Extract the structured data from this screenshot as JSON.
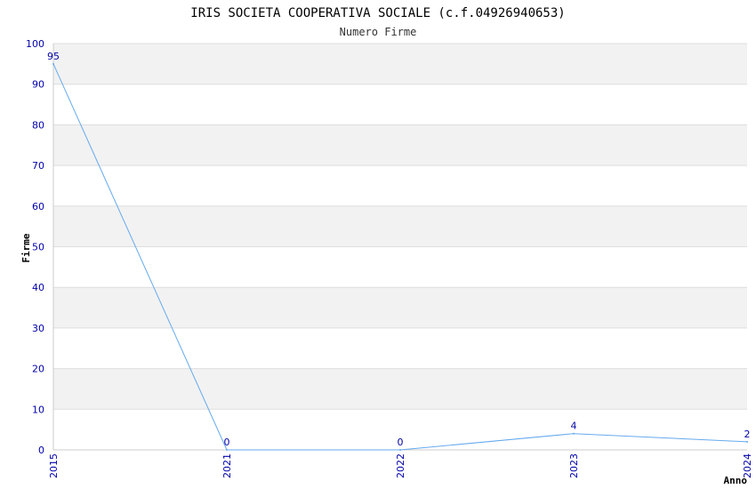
{
  "chart_data": {
    "type": "line",
    "title": "IRIS SOCIETA COOPERATIVA SOCIALE (c.f.04926940653)",
    "subtitle": "Numero Firme",
    "xlabel": "Anno",
    "ylabel": "Firme",
    "categories": [
      "2015",
      "2021",
      "2022",
      "2023",
      "2024"
    ],
    "series": [
      {
        "values": [
          95,
          0,
          0,
          4,
          2
        ]
      }
    ],
    "data_labels": [
      "95",
      "0",
      "0",
      "4",
      "2"
    ],
    "ylim": [
      0,
      100
    ],
    "yticks": [
      "0",
      "10",
      "20",
      "30",
      "40",
      "50",
      "60",
      "70",
      "80",
      "90",
      "100"
    ],
    "grid": true,
    "colors": {
      "line": "#66aaee",
      "band": "#f2f2f2",
      "gridline": "#dddddd",
      "tick_text": "#0000aa"
    }
  }
}
